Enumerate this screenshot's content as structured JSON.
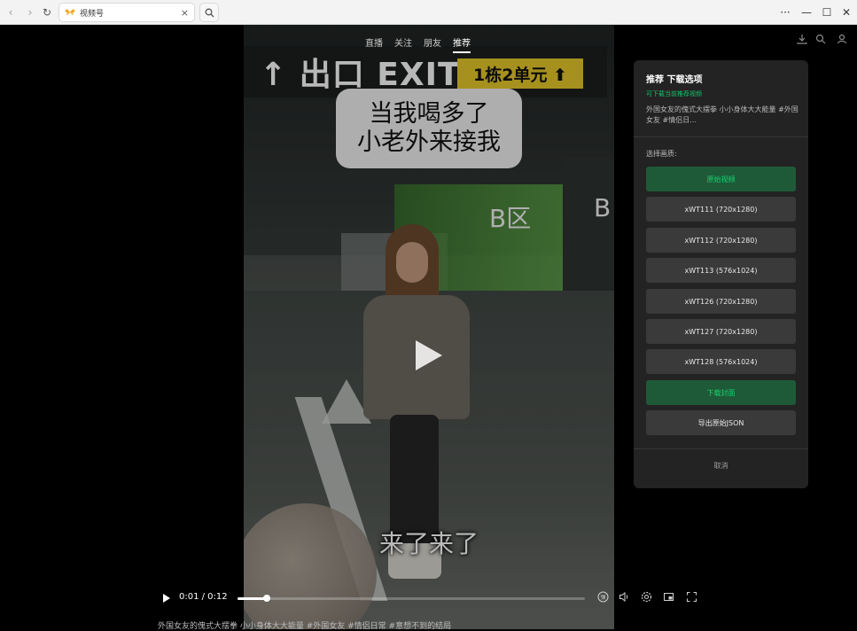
{
  "titlebar": {
    "tab_title": "视频号",
    "tab_close": "×",
    "search_icon": "⌕",
    "window_more": "···",
    "window_minimize": "—",
    "window_maximize": "☐",
    "window_close": "✕"
  },
  "nav": {
    "tabs": [
      "直播",
      "关注",
      "朋友",
      "推荐"
    ],
    "active_index": 3
  },
  "video": {
    "sign_exit": "↑ 出口 EXIT",
    "sign_building": "1栋2单元 ⬆",
    "bubble_line1": "当我喝多了",
    "bubble_line2": "小老外来接我",
    "zone_label": "B区",
    "zone_label_2": "B",
    "caption": "来了来了"
  },
  "panel": {
    "title": "推荐 下载选项",
    "subtitle": "可下载当前推荐视频",
    "description": "外国女友的傀式大摆拳 小小身体大大能量 #外国女友 #情侣日...",
    "quality_label": "选择画质:",
    "quality_options": [
      "原始视频",
      "xWT111 (720x1280)",
      "xWT112 (720x1280)",
      "xWT113 (576x1024)",
      "xWT126 (720x1280)",
      "xWT127 (720x1280)",
      "xWT128 (576x1024)"
    ],
    "download_cover": "下载封面",
    "export_json": "导出原始JSON",
    "cancel": "取消"
  },
  "player": {
    "time": "0:01 / 0:12",
    "progress_fraction": 0.083,
    "icons": [
      "danmaku-icon",
      "volume-icon",
      "settings-icon",
      "pip-icon",
      "fullscreen-icon"
    ]
  },
  "bottom_caption": "外国女友的傀式大摆拳 小小身体大大能量 #外国女友 #情侣日常 #意想不到的结局",
  "colors": {
    "accent_green": "#18d26f",
    "primary_button_bg": "#1e5a38",
    "panel_bg": "#232323"
  }
}
